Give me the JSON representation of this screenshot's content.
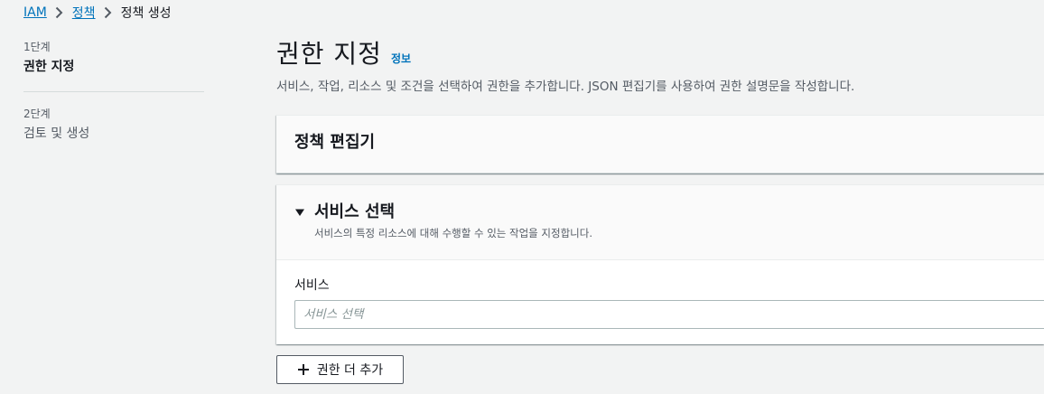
{
  "breadcrumb": {
    "items": [
      {
        "label": "IAM"
      },
      {
        "label": "정책"
      },
      {
        "label": "정책 생성"
      }
    ]
  },
  "steps": [
    {
      "number": "1단계",
      "title": "권한 지정"
    },
    {
      "number": "2단계",
      "title": "검토 및 생성"
    }
  ],
  "page": {
    "title": "권한 지정",
    "info_link": "정보",
    "description": "서비스, 작업, 리소스 및 조건을 선택하여 권한을 추가합니다. JSON 편집기를 사용하여 권한 설명문을 작성합니다."
  },
  "policy_editor": {
    "title": "정책 편집기"
  },
  "service_section": {
    "title": "서비스 선택",
    "description": "서비스의 특정 리소스에 대해 수행할 수 있는 작업을 지정합니다.",
    "field_label": "서비스",
    "input_placeholder": "서비스 선택",
    "input_value": ""
  },
  "actions": {
    "add_more_label": "권한 더 추가"
  },
  "icons": {
    "breadcrumb_separator": "chevron-right-icon",
    "collapse_toggle": "caret-down-icon",
    "add_button": "plus-icon"
  },
  "colors": {
    "link": "#0073bb",
    "text": "#16191f",
    "secondary_text": "#545b64",
    "background": "#f2f3f3"
  }
}
